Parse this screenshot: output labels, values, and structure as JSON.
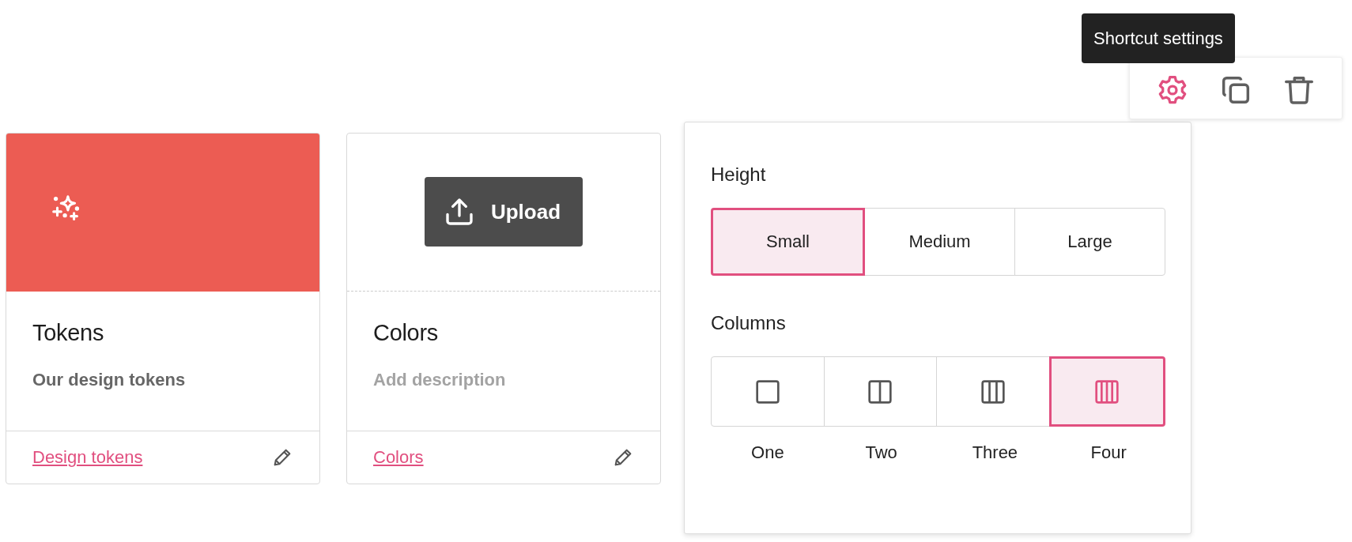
{
  "cards": [
    {
      "title": "Tokens",
      "description": "Our design tokens",
      "link": "Design tokens",
      "cover": {
        "kind": "color",
        "color": "#ec5c53"
      }
    },
    {
      "title": "Colors",
      "placeholder": "Add description",
      "link": "Colors",
      "cover": {
        "kind": "upload",
        "button": "Upload"
      }
    }
  ],
  "settings_panel": {
    "sections": [
      {
        "heading": "Height",
        "kind": "text",
        "options": [
          {
            "label": "Small",
            "selected": true
          },
          {
            "label": "Medium",
            "selected": false
          },
          {
            "label": "Large",
            "selected": false
          }
        ]
      },
      {
        "heading": "Columns",
        "kind": "columns",
        "options": [
          {
            "label": "One",
            "selected": false
          },
          {
            "label": "Two",
            "selected": false
          },
          {
            "label": "Three",
            "selected": false
          },
          {
            "label": "Four",
            "selected": true
          }
        ]
      }
    ]
  },
  "toolbar": {
    "tooltip": "Shortcut settings",
    "buttons": [
      {
        "kind": "settings",
        "active": true
      },
      {
        "kind": "duplicate",
        "active": false
      },
      {
        "kind": "delete",
        "active": false
      }
    ]
  }
}
